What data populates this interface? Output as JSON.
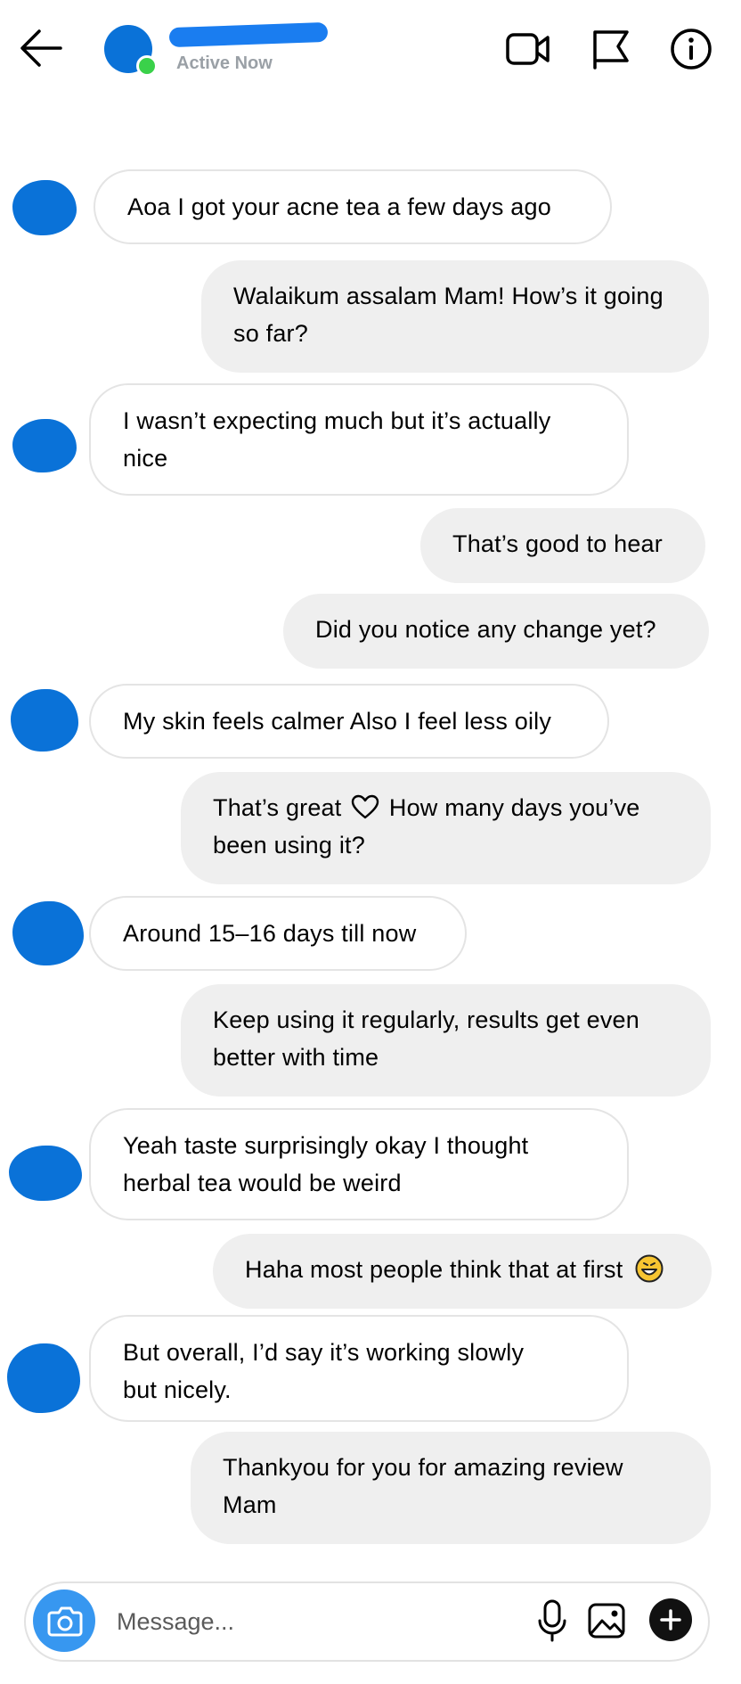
{
  "header": {
    "status": "Active Now",
    "status_dot_color": "#3ad14a",
    "icons": [
      "back-arrow-icon",
      "video-call-icon",
      "flag-icon",
      "info-icon"
    ]
  },
  "messages": [
    {
      "side": "in",
      "text": "Aoa I got your acne tea a few days ago"
    },
    {
      "side": "out",
      "text": "Walaikum assalam Mam! How’s it going so far?"
    },
    {
      "side": "in",
      "text": "I wasn’t expecting much but it’s actually nice"
    },
    {
      "side": "out",
      "text": "That’s good to hear"
    },
    {
      "side": "out",
      "text": "Did you notice any change yet?"
    },
    {
      "side": "in",
      "text": "My skin feels calmer Also I feel less oily"
    },
    {
      "side": "out",
      "text_before_icon": "That’s great",
      "icon": "heart-icon",
      "text_after_icon": "How many days you’ve",
      "text_line2": "been using it?"
    },
    {
      "side": "in",
      "text": "Around 15–16 days till now"
    },
    {
      "side": "out",
      "text": "Keep using it regularly, results get even better with time"
    },
    {
      "side": "in",
      "text": "Yeah taste surprisingly okay I thought herbal tea would be weird"
    },
    {
      "side": "out",
      "text": "Haha most people think that at first",
      "icon": "grinning-emoji-icon"
    },
    {
      "side": "in",
      "text_line1": "But overall, I’d say it’s working slowly",
      "text_line2": "but nicely."
    },
    {
      "side": "out",
      "text": "Thankyou for you for amazing review Mam"
    }
  ],
  "composer": {
    "placeholder": "Message...",
    "icons": [
      "camera-icon",
      "microphone-icon",
      "gallery-icon",
      "plus-icon"
    ],
    "accent_color": "#3797f0"
  },
  "colors": {
    "avatar_redaction": "#0a72d8",
    "incoming_bubble": "#ffffff",
    "outgoing_bubble": "#efefef"
  }
}
